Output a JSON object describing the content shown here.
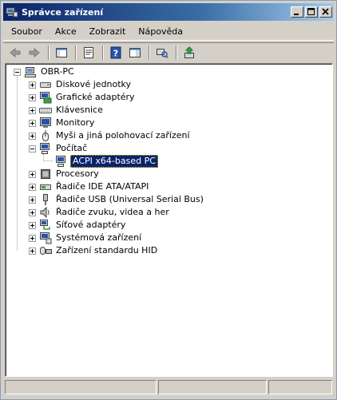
{
  "window": {
    "title": "Správce zařízení",
    "buttons": {
      "minimize": "_",
      "maximize": "□",
      "close": "✕"
    }
  },
  "menu": [
    "Soubor",
    "Akce",
    "Zobrazit",
    "Nápověda"
  ],
  "toolbar": {
    "buttons": [
      {
        "name": "back-icon"
      },
      {
        "name": "forward-icon"
      },
      {
        "name": "console-tree-icon"
      },
      {
        "name": "properties-icon"
      },
      {
        "name": "help-icon"
      },
      {
        "name": "show-hide-icon"
      },
      {
        "name": "scan-hardware-icon"
      },
      {
        "name": "update-driver-icon"
      }
    ]
  },
  "tree": {
    "root": "OBR-PC",
    "items": [
      {
        "label": "Diskové jednotky",
        "icon": "disk-drive-icon",
        "expanded": false
      },
      {
        "label": "Grafické adaptéry",
        "icon": "display-adapter-icon",
        "expanded": false
      },
      {
        "label": "Klávesnice",
        "icon": "keyboard-icon",
        "expanded": false
      },
      {
        "label": "Monitory",
        "icon": "monitor-icon",
        "expanded": false
      },
      {
        "label": "Myši a jiná polohovací zařízení",
        "icon": "mouse-icon",
        "expanded": false
      },
      {
        "label": "Počítač",
        "icon": "computer-icon",
        "expanded": true
      },
      {
        "label": "ACPI x64-based PC",
        "icon": "computer-icon",
        "child": true,
        "selected": true
      },
      {
        "label": "Procesory",
        "icon": "processor-icon",
        "expanded": false
      },
      {
        "label": "Řadiče IDE ATA/ATAPI",
        "icon": "ide-controller-icon",
        "expanded": false
      },
      {
        "label": "Řadiče USB (Universal Serial Bus)",
        "icon": "usb-controller-icon",
        "expanded": false
      },
      {
        "label": "Řadiče zvuku, videa a her",
        "icon": "sound-controller-icon",
        "expanded": false
      },
      {
        "label": "Síťové adaptéry",
        "icon": "network-adapter-icon",
        "expanded": false
      },
      {
        "label": "Systémová zařízení",
        "icon": "system-device-icon",
        "expanded": false
      },
      {
        "label": "Zařízení standardu HID",
        "icon": "hid-icon",
        "expanded": false
      }
    ]
  },
  "colors": {
    "titlebar_start": "#0a246a",
    "titlebar_end": "#a6caf0",
    "selection": "#0a246a",
    "chrome": "#d4d0c8"
  }
}
